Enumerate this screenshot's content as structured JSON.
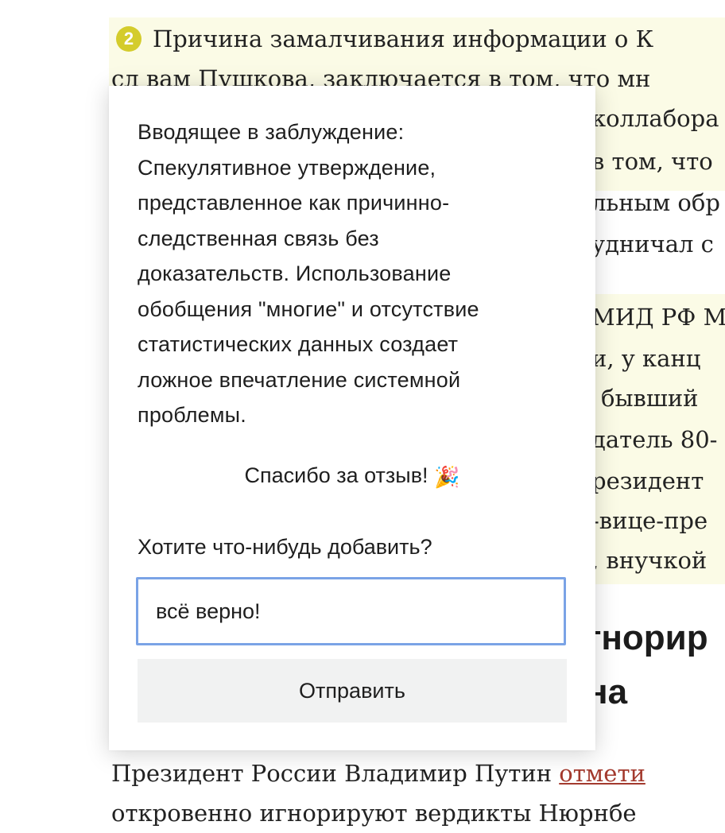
{
  "article": {
    "point_number": "2",
    "para1_lines": [
      "Причина замалчивания информации о К",
      "сл вам Пушкова, заключается в том, что мн",
      "коллабора",
      "в том, что",
      "льным обр",
      "удничал с"
    ],
    "para2_lines": [
      "МИД РФ М",
      "и, у канц",
      "бывший",
      "датель 80-",
      "резидент",
      "-вице-пре",
      ", внучкой"
    ],
    "heading_lines": [
      "гнорир",
      "на"
    ],
    "bottom_line1_text": "Президент России Владимир Путин ",
    "bottom_line1_link": "отмети",
    "bottom_line2": "откровенно игнорируют вердикты Нюрнбе"
  },
  "popup": {
    "verdict_lines": [
      "Вводящее в заблуждение:",
      "Спекулятивное утверждение,",
      "представленное как причинно-",
      "следственная связь без",
      "доказательств. Использование",
      "обобщения \"многие\" и отсутствие",
      "статистических данных создает",
      "ложное впечатление системной",
      "проблемы."
    ],
    "thanks_text": "Спасибо за отзыв!",
    "thanks_icon": "🎉",
    "add_label": "Хотите что-нибудь добавить?",
    "comment_value": "всё верно!",
    "send_label": "Отправить"
  },
  "colors": {
    "highlight": "#fbfbe6",
    "badge": "#d4cc2c",
    "input_focus_border": "#7aa3e6",
    "button_bg": "#f1f2f2",
    "link": "#a33a2e"
  }
}
